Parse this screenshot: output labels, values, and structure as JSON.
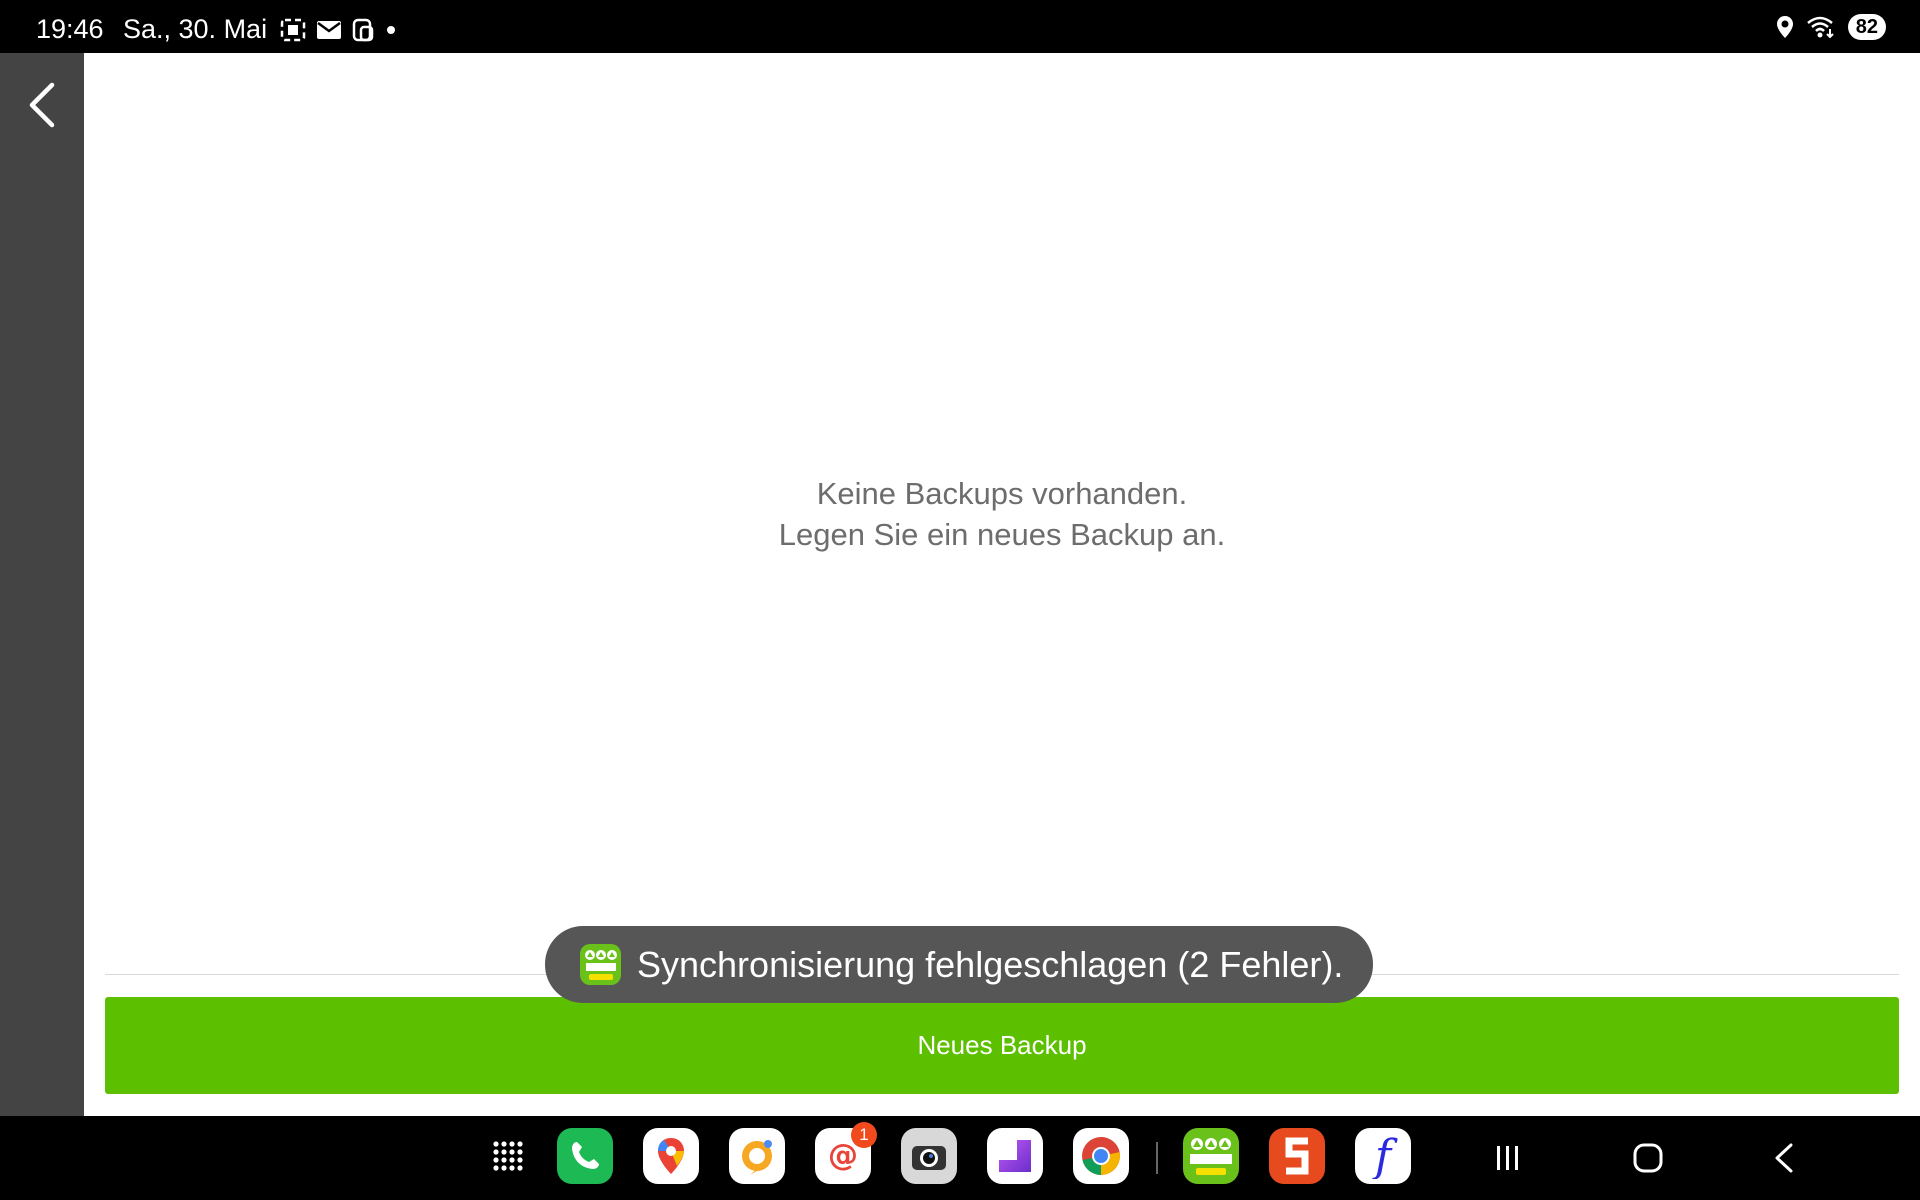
{
  "status_bar": {
    "time": "19:46",
    "date": "Sa., 30. Mai",
    "battery": "82",
    "left_icons": [
      "screenshot-icon",
      "mail-icon",
      "bixby-icon",
      "dot-icon"
    ],
    "right_icons": [
      "location-icon",
      "wifi-icon",
      "battery-icon"
    ]
  },
  "main": {
    "empty_line1": "Keine Backups vorhanden.",
    "empty_line2": "Legen Sie ein neues Backup an.",
    "new_backup_label": "Neues Backup"
  },
  "toast": {
    "message": "Synchronisierung fehlgeschlagen (2 Fehler).",
    "icon": "camping-app-icon"
  },
  "taskbar": {
    "apps": [
      {
        "name": "apps-grid-icon"
      },
      {
        "name": "phone-icon"
      },
      {
        "name": "maps-icon"
      },
      {
        "name": "orange-app-icon"
      },
      {
        "name": "mail-app-icon",
        "badge": "1"
      },
      {
        "name": "camera-icon"
      },
      {
        "name": "purple-app-icon"
      },
      {
        "name": "chrome-icon"
      },
      {
        "name": "camping-app-icon"
      },
      {
        "name": "s-app-icon"
      },
      {
        "name": "f-app-icon"
      }
    ],
    "nav": [
      "recents-icon",
      "home-icon",
      "back-nav-icon"
    ]
  },
  "colors": {
    "accent_green": "#5cbf00",
    "rail": "#444444",
    "toast_bg": "#565656",
    "badge": "#f04a1d"
  }
}
